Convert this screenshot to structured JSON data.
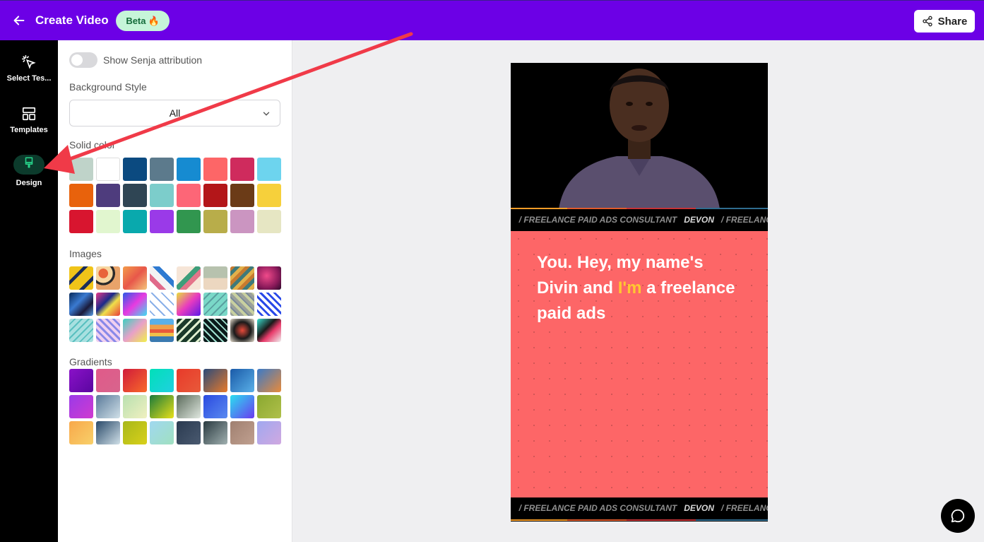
{
  "header": {
    "title": "Create Video",
    "beta_label": "Beta",
    "beta_emoji": "🔥",
    "share_label": "Share"
  },
  "nav": {
    "items": [
      {
        "label": "Select Tes...",
        "icon": "cursor-click-icon"
      },
      {
        "label": "Templates",
        "icon": "layout-icon"
      },
      {
        "label": "Design",
        "icon": "paintbrush-icon",
        "active": true
      }
    ]
  },
  "design": {
    "attribution_label": "Show Senja attribution",
    "attribution_on": false,
    "bg_style_label": "Background Style",
    "bg_style_value": "All",
    "solid_label": "Solid color",
    "images_label": "Images",
    "gradients_label": "Gradients",
    "solid_colors": [
      "#bfd3c9",
      "#ffffff",
      "#0b4a80",
      "#5c7a8c",
      "#168bd1",
      "#fd6667",
      "#cf2b5d",
      "#6dd4ee",
      "#e8620c",
      "#4e3c7d",
      "#2f4554",
      "#7ccdcb",
      "#fd6677",
      "#b31619",
      "#6b3b17",
      "#f6d03b",
      "#d8152f",
      "#e1f6cf",
      "#09a9ad",
      "#9a3ae8",
      "#31964f",
      "#b8ad4a",
      "#cb95c1",
      "#e6e6c3"
    ],
    "images": [
      "linear-gradient(135deg,#f0c419 0 30%,#1c2e5a 30% 40%,#f0c419 40% 70%,#1c2e5a 70% 80%,#f0c419 80%)",
      "radial-gradient(circle at 30% 30%,#e8643a 0 20%,#f7d6a0 21% 40%,#2a2a2a 41% 50%,#e8a36a 51%)",
      "linear-gradient(135deg,#f39c4a,#e8574a 50%,#f3c57a)",
      "linear-gradient(45deg,#ffffff 0 20%,#e06a8a 20% 35%,#f3f3f3 35% 55%,#2e7ad1 55% 70%,#ffffff 70%)",
      "linear-gradient(135deg,#f6e5d7 0 40%,#3e9e7a 40% 55%,#e4748a 55% 70%,#f6e5d7 70%)",
      "linear-gradient(180deg,#b7c2ae 0 50%,#ecd7c0 50%)",
      "repeating-linear-gradient(135deg,#c77a2f 0 5px,#3e7a7a 5px 10px,#e2b04a 10px 15px)",
      "radial-gradient(circle at 40% 40%,#f04a8a,#8a1a5a 60%,#2a0a2a)",
      "linear-gradient(135deg,#0a2a5a,#3a7ad1 40%,#1a1a3a 70%,#5aa0e8)",
      "linear-gradient(135deg,#e83a8a,#1a2a8a 40%,#f0e04a 60%,#e83a3a)",
      "linear-gradient(135deg,#2a5ae8,#e83ae0 50%,#3ae0f0)",
      "repeating-linear-gradient(45deg,#ffffff 0 4px,#8ab0e8 4px 6px,#ffffff 6px 10px)",
      "linear-gradient(135deg,#e8e03a,#e83ac0 50%,#5a1ae8)",
      "repeating-linear-gradient(135deg,#7ad8c8 0 6px,#5aa0a0 6px 8px)",
      "repeating-linear-gradient(45deg,#9aa09a 0 4px,#c8d0a0 4px 8px,#7a8a9a 8px 10px)",
      "repeating-linear-gradient(45deg,#ffffff 0 4px,#2a4ae8 4px 7px)",
      "repeating-linear-gradient(135deg,#a8e0e0 0 5px,#5ac0c0 5px 7px)",
      "repeating-linear-gradient(45deg,#f0d0f0 0 4px,#8a8ae8 4px 7px)",
      "linear-gradient(135deg,#3ad0c0,#e8a0c8 50%,#f0f04a)",
      "linear-gradient(180deg,#5ab0e8 0 25%,#f0a04a 25% 45%,#e85a3a 45% 60%,#f0c04a 60% 75%,#3a7ab0 75%)",
      "repeating-linear-gradient(135deg,#1a3a2a 0 6px,#e0f0d0 6px 9px)",
      "repeating-linear-gradient(45deg,#0a1a1a 0 5px,#a0e0d0 5px 7px)",
      "radial-gradient(circle at 50% 50%,#e84a3a,#1a1a1a 50%,#e8e0d0)",
      "linear-gradient(135deg,#3ae0d0,#1a1a1a 40%,#e83a6a 60%,#f0f0f0)"
    ],
    "gradients": [
      "linear-gradient(135deg,#8a11c8,#5a06a0)",
      "linear-gradient(135deg,#e05a8a,#d8648c)",
      "linear-gradient(135deg,#d01a3a,#f86a2a)",
      "linear-gradient(135deg,#00e0b8,#20d0e0)",
      "linear-gradient(135deg,#e83a2a,#e85a3a)",
      "linear-gradient(135deg,#2a4a7a,#e87a2a)",
      "linear-gradient(135deg,#1a5aa8,#5ab0e8)",
      "linear-gradient(135deg,#3a7ac8,#e88a3a)",
      "linear-gradient(135deg,#9a3ae8,#d03ad0)",
      "linear-gradient(135deg,#5a7a9a,#d0e0e8)",
      "linear-gradient(135deg,#b8e0b0,#f0f0c0)",
      "linear-gradient(135deg,#1a7a3a,#e8e01a)",
      "linear-gradient(135deg,#5a6a5a,#e0e8e0)",
      "linear-gradient(135deg,#2a4ae0,#5a8af0)",
      "linear-gradient(135deg,#2ae0f0,#6a3af0)",
      "linear-gradient(135deg,#8aa830,#b0c04a)",
      "linear-gradient(135deg,#f8a84a,#f8d06a)",
      "linear-gradient(135deg,#2a4a6a,#d0e0e8)",
      "linear-gradient(135deg,#a8b81a,#d8d01a)",
      "linear-gradient(135deg,#a0d8f0,#a0e0c0)",
      "linear-gradient(135deg,#2a3a50,#4a5a70)",
      "linear-gradient(135deg,#2a3a40,#a0b0b0)",
      "linear-gradient(135deg,#a08070,#c0a090)",
      "linear-gradient(135deg,#a0a8f0,#d0a8e0)"
    ]
  },
  "preview": {
    "ticker_segments": [
      {
        "text": "/ FREELANCE PAID ADS CONSULTANT",
        "highlight": false
      },
      {
        "text": "DEVON",
        "highlight": true
      },
      {
        "text": "/ FREELANCE",
        "highlight": false
      }
    ],
    "caption_before": "You. Hey, my name's Divin and ",
    "caption_highlight": "I'm",
    "caption_after": " a freelance paid ads",
    "card_color": "#fd6667",
    "highlight_color": "#ffc631"
  },
  "colors": {
    "brand": "#6c00e6",
    "annotation_arrow": "#f03a48"
  }
}
